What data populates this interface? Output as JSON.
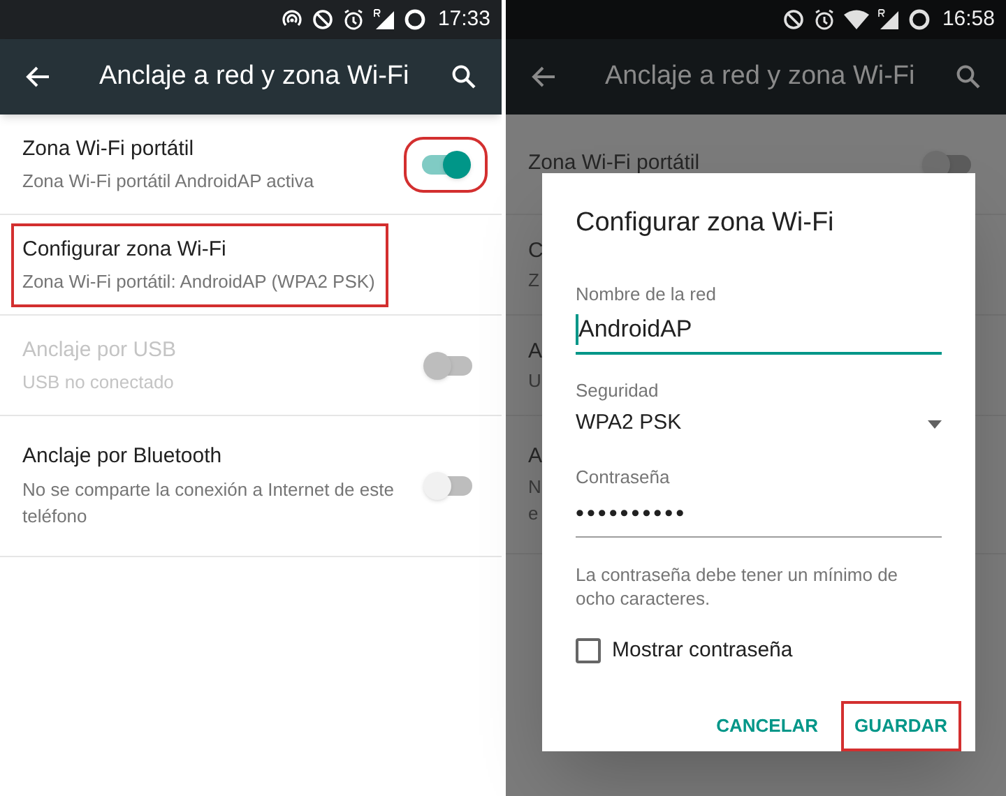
{
  "left": {
    "status_bar": {
      "time": "17:33"
    },
    "toolbar": {
      "title": "Anclaje a red y zona Wi-Fi"
    },
    "rows": [
      {
        "kind": "toggle",
        "title": "Zona Wi-Fi portátil",
        "subtitle": "Zona Wi-Fi portátil AndroidAP activa",
        "disabled": false,
        "on": true,
        "highlighted": true
      },
      {
        "kind": "plain",
        "title": "Configurar zona Wi-Fi",
        "subtitle": "Zona Wi-Fi portátil: AndroidAP (WPA2 PSK)",
        "disabled": false,
        "highlighted": true
      },
      {
        "kind": "toggle",
        "title": "Anclaje por USB",
        "subtitle": "USB no conectado",
        "disabled": true,
        "on": false,
        "highlighted": false
      },
      {
        "kind": "toggle",
        "title": "Anclaje por Bluetooth",
        "subtitle": "No se comparte la conexión a Internet de este teléfono",
        "disabled": false,
        "on": false,
        "highlighted": false
      }
    ]
  },
  "right": {
    "status_bar": {
      "time": "16:58"
    },
    "toolbar": {
      "title": "Anclaje a red y zona Wi-Fi"
    },
    "background_rows": [
      {
        "kind": "toggle",
        "title": "Zona Wi-Fi portátil",
        "subtitle_lines": [],
        "on": false
      },
      {
        "kind": "plain",
        "title": "C",
        "subtitle_lines": [
          "Z"
        ]
      },
      {
        "kind": "plain",
        "title": "A",
        "subtitle_lines": [
          "U"
        ]
      },
      {
        "kind": "plain",
        "title": "A",
        "subtitle_lines": [
          "N",
          "e"
        ]
      }
    ],
    "dialog": {
      "title": "Configurar zona Wi-Fi",
      "fields": [
        {
          "kind": "text",
          "label": "Nombre de la red",
          "value": "AndroidAP",
          "focused": true
        },
        {
          "kind": "select",
          "label": "Seguridad",
          "value": "WPA2 PSK"
        },
        {
          "kind": "password",
          "label": "Contraseña",
          "value": "••••••••••",
          "focused": false
        }
      ],
      "hint": "La contraseña debe tener un mínimo de ocho caracteres.",
      "checkbox": {
        "label": "Mostrar contraseña",
        "checked": false
      },
      "buttons": [
        {
          "label": "CANCELAR",
          "highlighted": false
        },
        {
          "label": "GUARDAR",
          "highlighted": true
        }
      ]
    }
  }
}
